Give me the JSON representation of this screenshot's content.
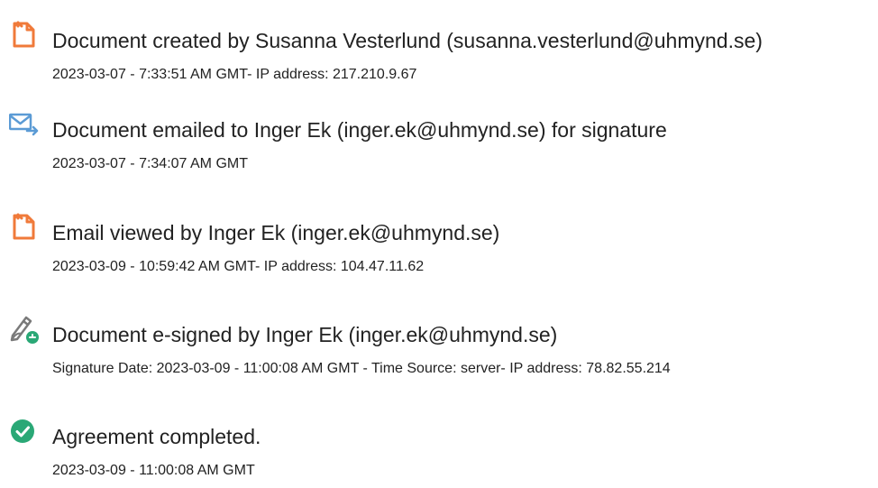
{
  "audit_events": [
    {
      "icon": "document-created-icon",
      "title": "Document created by Susanna Vesterlund (susanna.vesterlund@uhmynd.se)",
      "detail": "2023-03-07 - 7:33:51 AM GMT- IP address: 217.210.9.67"
    },
    {
      "icon": "email-sent-icon",
      "title": "Document emailed to Inger Ek (inger.ek@uhmynd.se) for signature",
      "detail": "2023-03-07 - 7:34:07 AM GMT"
    },
    {
      "icon": "email-viewed-icon",
      "title": "Email viewed by Inger Ek (inger.ek@uhmynd.se)",
      "detail": "2023-03-09 - 10:59:42 AM GMT- IP address: 104.47.11.62"
    },
    {
      "icon": "e-signed-pen-icon",
      "title": "Document e-signed by Inger Ek (inger.ek@uhmynd.se)",
      "detail": "Signature Date: 2023-03-09 - 11:00:08 AM GMT - Time Source: server- IP address: 78.82.55.214"
    },
    {
      "icon": "check-circle-icon",
      "title": "Agreement completed.",
      "detail": "2023-03-09 - 11:00:08 AM GMT"
    }
  ],
  "colors": {
    "document_icon": "#f07a3a",
    "email_icon": "#5b9bd5",
    "pen_icon": "#7a7a7a",
    "signed_badge": "#2aa876",
    "complete_check": "#2aa876",
    "text": "#222222"
  }
}
